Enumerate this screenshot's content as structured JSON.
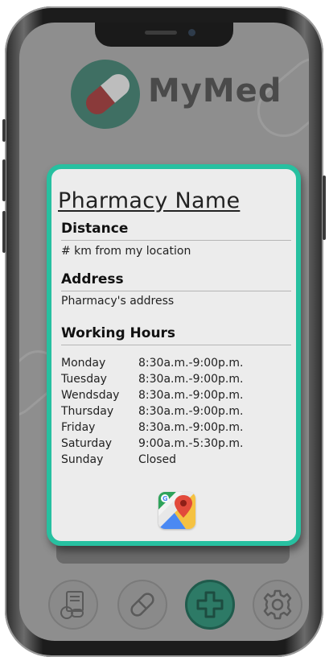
{
  "app": {
    "title": "MyMed"
  },
  "pharmacy": {
    "name": "Pharmacy Name",
    "distance_label": "Distance",
    "distance_value": "# km from my location",
    "address_label": "Address",
    "address_value": "Pharmacy's address",
    "hours_label": "Working Hours",
    "hours": [
      {
        "day": "Monday",
        "time": "8:30a.m.-9:00p.m."
      },
      {
        "day": "Tuesday",
        "time": "8:30a.m.-9:00p.m."
      },
      {
        "day": "Wendsday",
        "time": "8:30a.m.-9:00p.m."
      },
      {
        "day": "Thursday",
        "time": "8:30a.m.-9:00p.m."
      },
      {
        "day": "Friday",
        "time": "8:30a.m.-9:00p.m."
      },
      {
        "day": "Saturday",
        "time": "9:00a.m.-5:30p.m."
      },
      {
        "day": "Sunday",
        "time": "Closed"
      }
    ]
  },
  "icons": {
    "maps": "google-maps-icon",
    "nav": [
      "prescription-icon",
      "pill-icon",
      "plus-icon",
      "gear-icon"
    ]
  },
  "colors": {
    "accent": "#27c0a0",
    "active_nav": "#2d7a66",
    "logo_red": "#8a3a3a"
  }
}
